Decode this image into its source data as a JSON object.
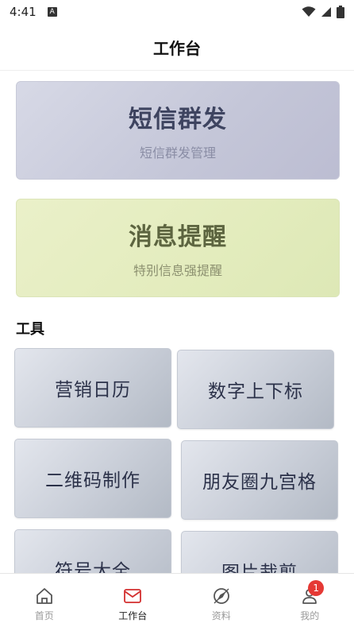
{
  "status_bar": {
    "time": "4:41",
    "notification_icon": "A"
  },
  "header": {
    "title": "工作台"
  },
  "banners": [
    {
      "title": "短信群发",
      "subtitle": "短信群发管理"
    },
    {
      "title": "消息提醒",
      "subtitle": "特别信息强提醒"
    }
  ],
  "tools_section": {
    "title": "工具",
    "items": [
      {
        "label": "营销日历"
      },
      {
        "label": "数字上下标"
      },
      {
        "label": "二维码制作"
      },
      {
        "label": "朋友圈九宫格"
      },
      {
        "label": "符号大全"
      },
      {
        "label": "图片裁剪"
      }
    ]
  },
  "tabbar": {
    "items": [
      {
        "label": "首页",
        "icon": "home-icon"
      },
      {
        "label": "工作台",
        "icon": "mail-icon",
        "active": true
      },
      {
        "label": "资料",
        "icon": "compass-icon"
      },
      {
        "label": "我的",
        "icon": "user-icon",
        "badge": "1"
      }
    ]
  },
  "colors": {
    "sms_banner": "#c8cad8",
    "remind_banner": "#e3ecbd",
    "badge": "#e53935"
  }
}
